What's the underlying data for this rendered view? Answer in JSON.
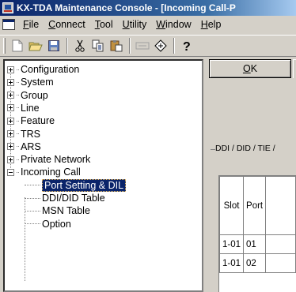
{
  "window": {
    "title": "KX-TDA Maintenance Console - [Incoming Call-P"
  },
  "menubar": {
    "items": [
      {
        "accel": "F",
        "rest": "ile"
      },
      {
        "accel": "C",
        "rest": "onnect"
      },
      {
        "accel": "T",
        "rest": "ool"
      },
      {
        "accel": "U",
        "rest": "tility"
      },
      {
        "accel": "W",
        "rest": "indow"
      },
      {
        "accel": "H",
        "rest": "elp"
      }
    ]
  },
  "toolbar": {
    "buttons": [
      "new-icon",
      "open-icon",
      "save-icon",
      "cut-icon",
      "copy-icon",
      "paste-icon",
      "connect-icon",
      "disconnect-icon",
      "help-icon"
    ]
  },
  "tree": {
    "items": [
      {
        "label": "Configuration",
        "level": 0,
        "expander": "plus"
      },
      {
        "label": "System",
        "level": 0,
        "expander": "plus"
      },
      {
        "label": "Group",
        "level": 0,
        "expander": "plus"
      },
      {
        "label": "Line",
        "level": 0,
        "expander": "plus"
      },
      {
        "label": "Feature",
        "level": 0,
        "expander": "plus"
      },
      {
        "label": "TRS",
        "level": 0,
        "expander": "plus"
      },
      {
        "label": "ARS",
        "level": 0,
        "expander": "plus"
      },
      {
        "label": "Private Network",
        "level": 0,
        "expander": "plus"
      },
      {
        "label": "Incoming Call",
        "level": 0,
        "expander": "minus"
      },
      {
        "label": "Port Setting & DIL",
        "level": 1,
        "selected": true
      },
      {
        "label": "DDI/DID Table",
        "level": 1
      },
      {
        "label": "MSN Table",
        "level": 1
      },
      {
        "label": "Option",
        "level": 1
      }
    ]
  },
  "form": {
    "ok_label": "OK",
    "ok_accel": "O",
    "ok_rest": "K",
    "group_label": "DDI / DID / TIE /"
  },
  "table": {
    "headers": [
      "Slot",
      "Port"
    ],
    "rows": [
      [
        "1-01",
        "01"
      ],
      [
        "1-01",
        "02"
      ]
    ]
  }
}
